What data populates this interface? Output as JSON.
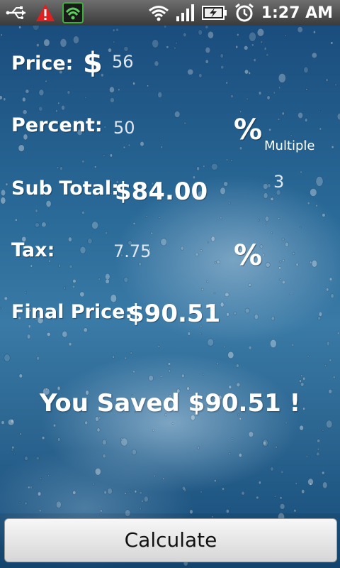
{
  "status_bar": {
    "time": "1:27 AM",
    "icons": [
      "usb-icon",
      "warning-icon",
      "security-app-icon",
      "wifi-icon",
      "signal-icon",
      "battery-charging-icon",
      "alarm-icon"
    ]
  },
  "form": {
    "price_label": "Price:",
    "currency_symbol": "$",
    "price_value": "56",
    "percent_label": "Percent:",
    "percent_value": "50",
    "percent_symbol": "%",
    "multiple_label": "Multiple",
    "multiple_value": "3",
    "subtotal_label": "Sub Total:",
    "subtotal_value": "$84.00",
    "tax_label": "Tax:",
    "tax_value": "7.75",
    "tax_symbol": "%",
    "final_label": "Final Price:",
    "final_value": "$90.51"
  },
  "saved_text": "You Saved $90.51 !",
  "calculate_button": "Calculate",
  "colors": {
    "text": "#ffffff",
    "input_text": "#dfe8f0",
    "background": "#2a6a98"
  }
}
